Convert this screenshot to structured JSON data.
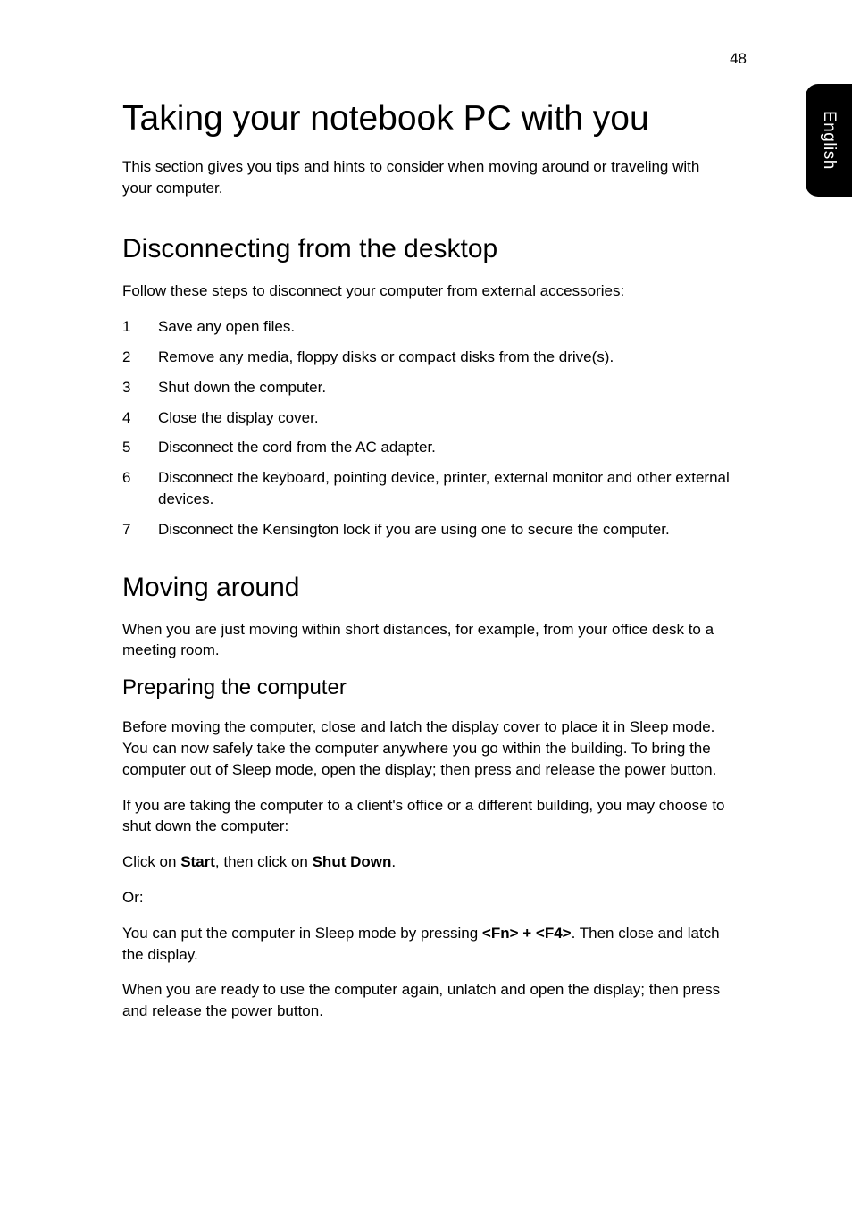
{
  "pageNumber": "48",
  "sideTab": "English",
  "h1": "Taking your notebook PC with you",
  "intro": "This section gives you tips and hints to consider when moving around or traveling with your computer.",
  "section1": {
    "heading": "Disconnecting from the desktop",
    "intro": "Follow these steps to disconnect your computer from external accessories:",
    "steps": [
      "Save any open files.",
      "Remove any media, floppy disks or compact disks from the drive(s).",
      "Shut down the computer.",
      "Close the display cover.",
      "Disconnect the cord from the AC adapter.",
      "Disconnect the keyboard, pointing device, printer, external monitor and other external devices.",
      "Disconnect the Kensington lock if you are using one to secure the computer."
    ]
  },
  "section2": {
    "heading": "Moving around",
    "intro": "When you are just moving within short distances, for example, from your office desk to a meeting room.",
    "sub": {
      "heading": "Preparing the computer",
      "p1": "Before moving the computer, close and latch the display cover to place it in Sleep mode. You can now safely take the computer anywhere you go within the building. To bring the computer out of Sleep mode, open the display; then press and release the power button.",
      "p2": "If you are taking the computer to a client's office or a different building, you may choose to shut down the computer:",
      "p3_pre": "Click on ",
      "p3_b1": "Start",
      "p3_mid": ", then click on ",
      "p3_b2": "Shut Down",
      "p3_post": ".",
      "p4": "Or:",
      "p5_pre": "You can put the computer in Sleep mode by pressing ",
      "p5_b1": "<Fn> + <F4>",
      "p5_post": ". Then close and latch the display.",
      "p6": "When you are ready to use the computer again, unlatch and open the display; then press and release the power button."
    }
  }
}
